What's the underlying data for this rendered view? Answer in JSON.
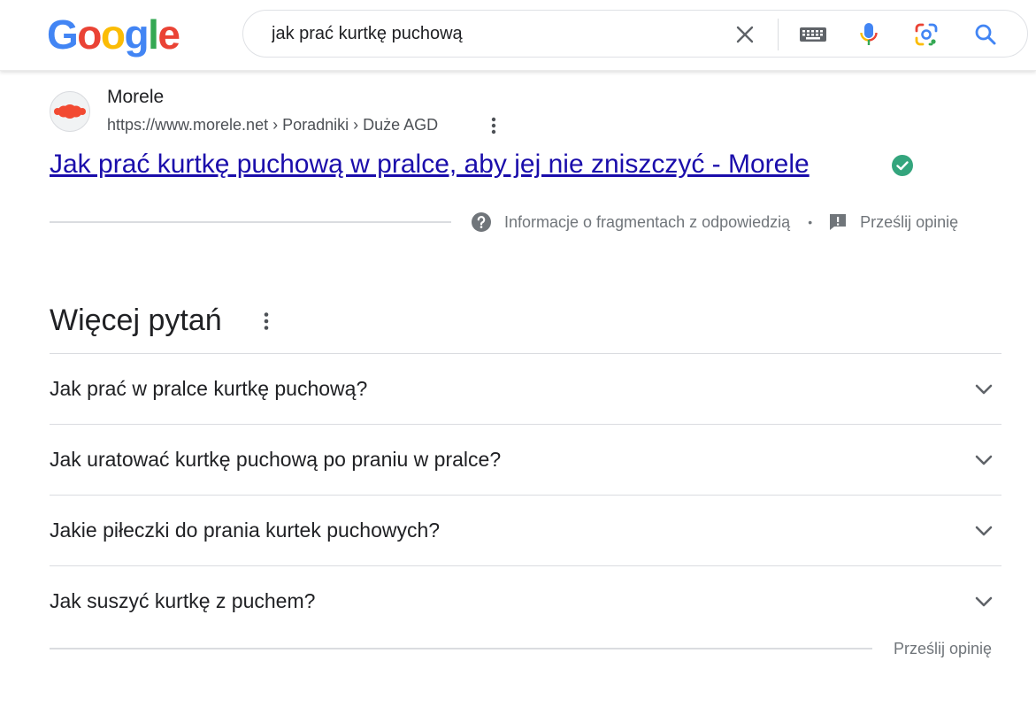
{
  "header": {
    "logo_letters": [
      "G",
      "o",
      "o",
      "g",
      "l",
      "e"
    ],
    "logo_colors": [
      "#4285F4",
      "#EA4335",
      "#FBBC05",
      "#4285F4",
      "#34A853",
      "#EA4335"
    ],
    "search": {
      "value": "jak prać kurtkę puchową"
    },
    "icons": [
      "clear-icon",
      "keyboard-icon",
      "microphone-icon",
      "google-lens-icon",
      "search-icon"
    ]
  },
  "result": {
    "site_name": "Morele",
    "url": "https://www.morele.net › Poradniki › Duże AGD",
    "title": "Jak prać kurtkę puchową w pralce, aby jej nie zniszczyć - Morele",
    "title_color": "#1a0dab",
    "snippet_info": "Informacje o fragmentach z odpowiedzią",
    "separator": "•",
    "feedback": "Prześlij opinię"
  },
  "more_questions": {
    "title": "Więcej pytań",
    "questions": [
      "Jak prać w pralce kurtkę puchową?",
      "Jak uratować kurtkę puchową po praniu w pralce?",
      "Jakie piłeczki do prania kurtek puchowych?",
      "Jak suszyć kurtkę z puchem?"
    ],
    "feedback": "Prześlij opinię"
  }
}
